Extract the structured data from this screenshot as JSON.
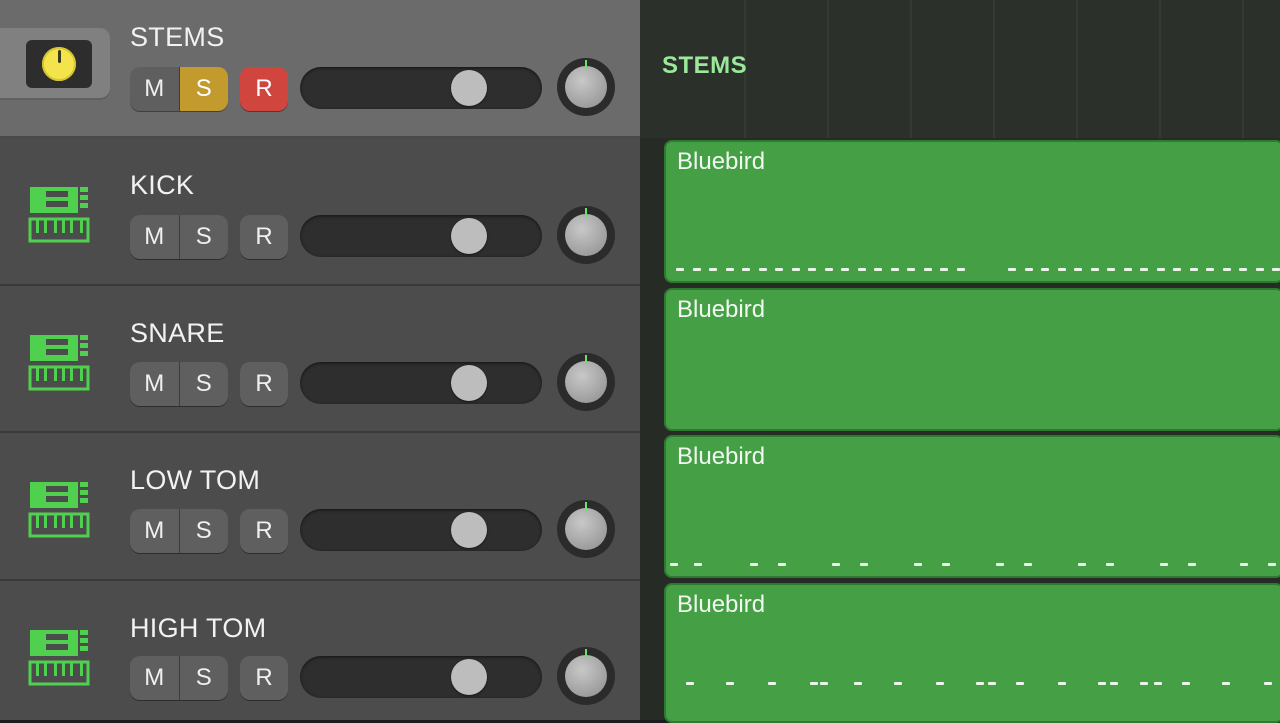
{
  "tracks": [
    {
      "name": "STEMS",
      "mute": "M",
      "solo": "S",
      "record": "R",
      "solo_on": true,
      "record_on": true,
      "volume": 0.7,
      "type": "folder"
    },
    {
      "name": "KICK",
      "mute": "M",
      "solo": "S",
      "record": "R",
      "solo_on": false,
      "record_on": false,
      "volume": 0.7,
      "type": "instrument"
    },
    {
      "name": "SNARE",
      "mute": "M",
      "solo": "S",
      "record": "R",
      "solo_on": false,
      "record_on": false,
      "volume": 0.7,
      "type": "instrument"
    },
    {
      "name": "LOW TOM",
      "mute": "M",
      "solo": "S",
      "record": "R",
      "solo_on": false,
      "record_on": false,
      "volume": 0.7,
      "type": "instrument"
    },
    {
      "name": "HIGH TOM",
      "mute": "M",
      "solo": "S",
      "record": "R",
      "solo_on": false,
      "record_on": false,
      "volume": 0.7,
      "type": "instrument"
    }
  ],
  "timeline": {
    "folder_label": "STEMS",
    "regions": [
      {
        "name": "Bluebird"
      },
      {
        "name": "Bluebird"
      },
      {
        "name": "Bluebird"
      },
      {
        "name": "Bluebird"
      }
    ]
  },
  "colors": {
    "solo_on": "#c29a2e",
    "record_on": "#d0453e",
    "region": "#45a045",
    "instrument_icon": "#4fd14f"
  },
  "icons": {
    "folder": "yellow-knob-icon",
    "instrument": "software-instrument-icon",
    "pan": "pan-knob-icon"
  }
}
